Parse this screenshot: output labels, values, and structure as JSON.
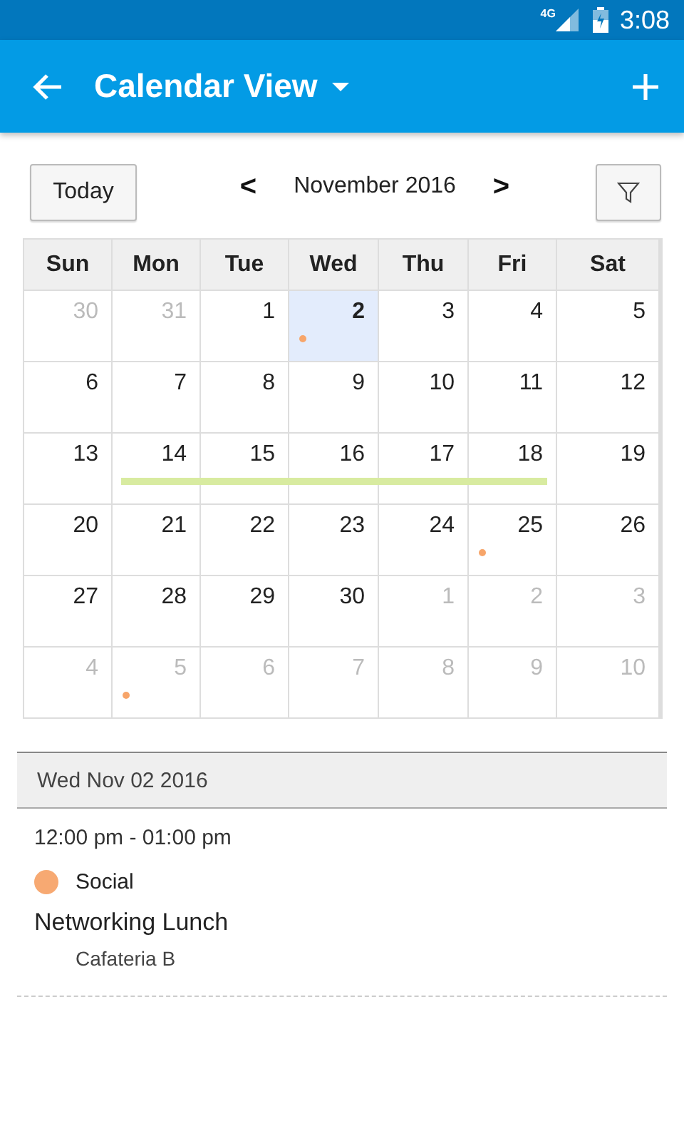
{
  "status_bar": {
    "network": "4G",
    "time": "3:08"
  },
  "app_bar": {
    "title": "Calendar View"
  },
  "toolbar": {
    "today": "Today",
    "prev": "<",
    "month": "November 2016",
    "next": ">"
  },
  "weekdays": [
    "Sun",
    "Mon",
    "Tue",
    "Wed",
    "Thu",
    "Fri",
    "Sat"
  ],
  "weeks": [
    [
      {
        "label": "30",
        "in_month": false,
        "selected": false
      },
      {
        "label": "31",
        "in_month": false,
        "selected": false
      },
      {
        "label": "1",
        "in_month": true,
        "selected": false
      },
      {
        "label": "2",
        "in_month": true,
        "selected": true,
        "events": [
          {
            "kind": "dot",
            "color": "#f7a56a"
          }
        ]
      },
      {
        "label": "3",
        "in_month": true,
        "selected": false
      },
      {
        "label": "4",
        "in_month": true,
        "selected": false
      },
      {
        "label": "5",
        "in_month": true,
        "selected": false
      }
    ],
    [
      {
        "label": "6",
        "in_month": true,
        "selected": false
      },
      {
        "label": "7",
        "in_month": true,
        "selected": false
      },
      {
        "label": "8",
        "in_month": true,
        "selected": false
      },
      {
        "label": "9",
        "in_month": true,
        "selected": false
      },
      {
        "label": "10",
        "in_month": true,
        "selected": false
      },
      {
        "label": "11",
        "in_month": true,
        "selected": false
      },
      {
        "label": "12",
        "in_month": true,
        "selected": false
      }
    ],
    [
      {
        "label": "13",
        "in_month": true,
        "selected": false
      },
      {
        "label": "14",
        "in_month": true,
        "selected": false,
        "events": [
          {
            "kind": "bar",
            "color": "#d8eba0"
          }
        ]
      },
      {
        "label": "15",
        "in_month": true,
        "selected": false,
        "events": [
          {
            "kind": "bar",
            "color": "#d8eba0"
          }
        ]
      },
      {
        "label": "16",
        "in_month": true,
        "selected": false,
        "events": [
          {
            "kind": "bar",
            "color": "#d8eba0"
          }
        ]
      },
      {
        "label": "17",
        "in_month": true,
        "selected": false,
        "events": [
          {
            "kind": "bar",
            "color": "#d8eba0"
          }
        ]
      },
      {
        "label": "18",
        "in_month": true,
        "selected": false,
        "events": [
          {
            "kind": "bar",
            "color": "#d8eba0"
          }
        ]
      },
      {
        "label": "19",
        "in_month": true,
        "selected": false
      }
    ],
    [
      {
        "label": "20",
        "in_month": true,
        "selected": false
      },
      {
        "label": "21",
        "in_month": true,
        "selected": false
      },
      {
        "label": "22",
        "in_month": true,
        "selected": false
      },
      {
        "label": "23",
        "in_month": true,
        "selected": false
      },
      {
        "label": "24",
        "in_month": true,
        "selected": false
      },
      {
        "label": "25",
        "in_month": true,
        "selected": false,
        "events": [
          {
            "kind": "dot",
            "color": "#f7a56a"
          }
        ]
      },
      {
        "label": "26",
        "in_month": true,
        "selected": false
      }
    ],
    [
      {
        "label": "27",
        "in_month": true,
        "selected": false
      },
      {
        "label": "28",
        "in_month": true,
        "selected": false
      },
      {
        "label": "29",
        "in_month": true,
        "selected": false
      },
      {
        "label": "30",
        "in_month": true,
        "selected": false
      },
      {
        "label": "1",
        "in_month": false,
        "selected": false
      },
      {
        "label": "2",
        "in_month": false,
        "selected": false
      },
      {
        "label": "3",
        "in_month": false,
        "selected": false
      }
    ],
    [
      {
        "label": "4",
        "in_month": false,
        "selected": false
      },
      {
        "label": "5",
        "in_month": false,
        "selected": false,
        "events": [
          {
            "kind": "dot",
            "color": "#f7a56a"
          }
        ]
      },
      {
        "label": "6",
        "in_month": false,
        "selected": false
      },
      {
        "label": "7",
        "in_month": false,
        "selected": false
      },
      {
        "label": "8",
        "in_month": false,
        "selected": false
      },
      {
        "label": "9",
        "in_month": false,
        "selected": false
      },
      {
        "label": "10",
        "in_month": false,
        "selected": false
      }
    ]
  ],
  "agenda": {
    "date": "Wed Nov 02 2016",
    "events": [
      {
        "time": "12:00 pm - 01:00 pm",
        "category": "Social",
        "color": "#f7a972",
        "title": "Networking Lunch",
        "location": "Cafateria B"
      }
    ]
  }
}
